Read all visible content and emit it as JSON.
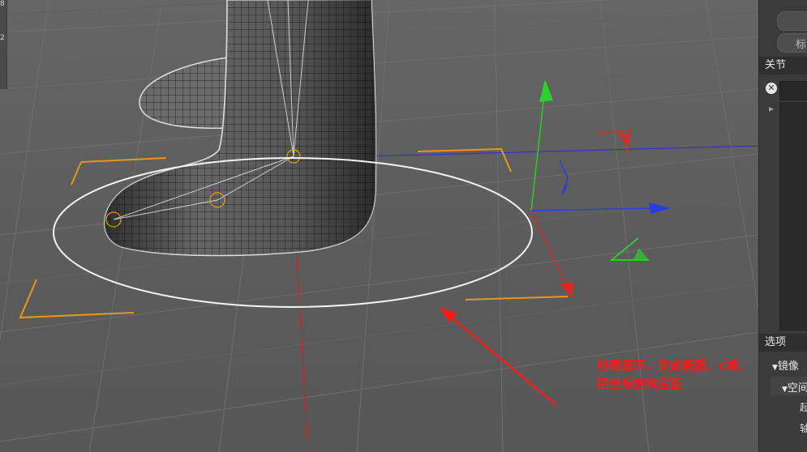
{
  "ruler": {
    "labels": [
      "8",
      "2"
    ]
  },
  "annotation": {
    "line1": "创建圆环，变成椭圆，c掉，",
    "line2": "把坐标放到后面",
    "color": "#ff1818"
  },
  "panel": {
    "button2_label": "标",
    "joint_header": "关节",
    "close_symbol": "✕",
    "options_header": "选项",
    "mirror_label": "镜像",
    "space_label": "空间",
    "row_a": "起",
    "row_b": "轴"
  },
  "gizmo": {
    "x_color": "#e22626",
    "y_color": "#2bd22b",
    "z_color": "#2b3de0"
  },
  "icons": [
    "close-icon",
    "expand-triangle-icon",
    "dropdown-arrow-icon"
  ]
}
